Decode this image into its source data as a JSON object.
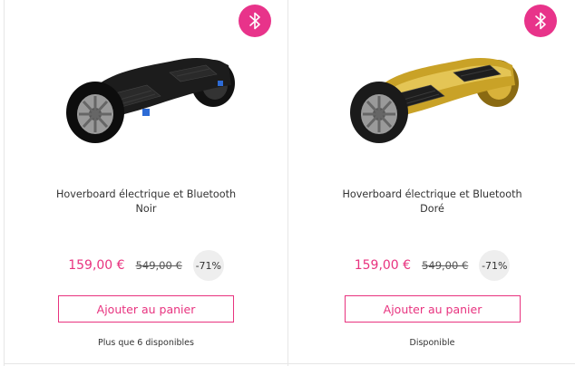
{
  "products": [
    {
      "title_line1": "Hoverboard électrique et Bluetooth",
      "title_line2": "Noir",
      "price": "159,00 €",
      "old_price": "549,00 €",
      "discount": "-71%",
      "button_label": "Ajouter au panier",
      "stock": "Plus que 6 disponibles",
      "badge_icon": "bluetooth-icon",
      "color": "#1a1a1a"
    },
    {
      "title_line1": "Hoverboard électrique et Bluetooth",
      "title_line2": "Doré",
      "price": "159,00 €",
      "old_price": "549,00 €",
      "discount": "-71%",
      "button_label": "Ajouter au panier",
      "stock": "Disponible",
      "badge_icon": "bluetooth-icon",
      "color": "#c9a227"
    }
  ],
  "theme": {
    "accent": "#e8337f",
    "badge": "#e8338a"
  }
}
